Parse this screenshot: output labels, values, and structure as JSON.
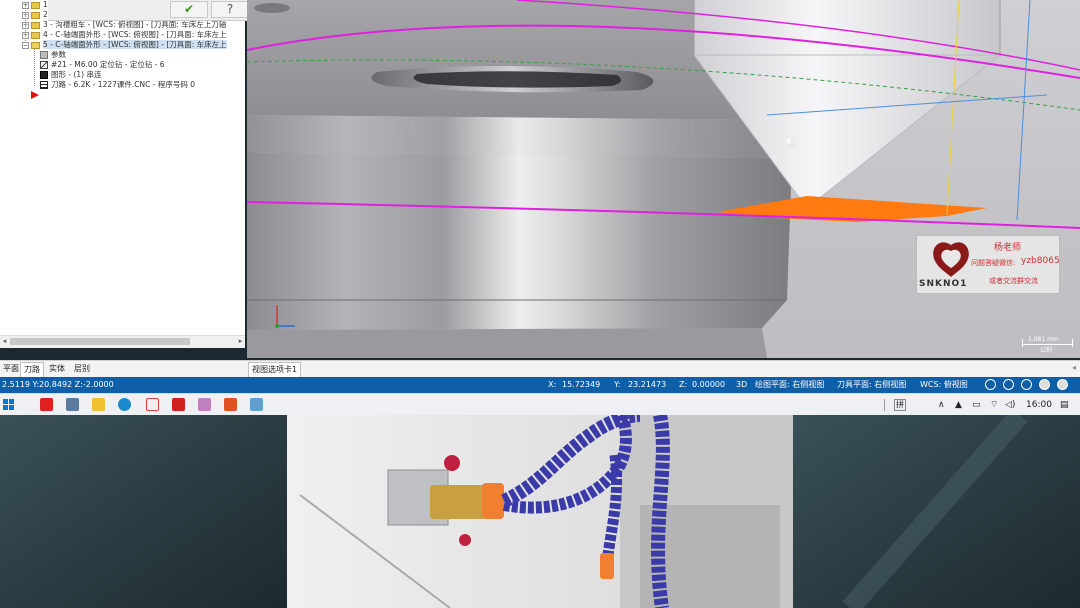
{
  "tree": {
    "rows": [
      {
        "label": "1 - ",
        "indent": 0,
        "kind": "folder"
      },
      {
        "label": "2 - ",
        "indent": 0,
        "kind": "folder"
      },
      {
        "label": "3 - 沟槽粗车 - [WCS: 俯视图] - [刀具面: 车床左上刀轴",
        "indent": 0,
        "kind": "folder"
      },
      {
        "label": "4 - C-轴端面外形 - [WCS: 俯视图] - [刀具面: 车床左上",
        "indent": 0,
        "kind": "folder"
      },
      {
        "label": "5 - C-轴端面外形 - [WCS: 俯视图] - [刀具面: 车床左上",
        "indent": 0,
        "kind": "folder-selected"
      },
      {
        "label": "参数",
        "indent": 1,
        "kind": "params"
      },
      {
        "label": "#21 - M6.00 定位钻 - 定位钻 - 6",
        "indent": 1,
        "kind": "tool"
      },
      {
        "label": "图形 - (1) 串连",
        "indent": 1,
        "kind": "geometry"
      },
      {
        "label": "刀路 - 6.2K - 1227课件.CNC - 程序号码 0",
        "indent": 1,
        "kind": "toolpath"
      }
    ],
    "ok_icon": "check-icon",
    "help_icon": "help-icon"
  },
  "tabs": {
    "left": [
      "平面",
      "刀路",
      "实体",
      "层别"
    ],
    "active_left": "刀路",
    "viewport_tab": "视图选项卡1"
  },
  "watermark": {
    "logo_text": "SNKNO1",
    "teacher": "杨老师",
    "contact_label": "问题答疑微信:",
    "wechat": "yzb8065",
    "group": "或者交流群交流"
  },
  "scale": {
    "value": "1.081 mm",
    "unit": "公制"
  },
  "status": {
    "left_coords": "2.5119  Y:20.8492  Z:-2.0000",
    "x_label": "X:",
    "x_value": "15.72349",
    "y_label": "Y:",
    "y_value": "23.21473",
    "z_label": "Z:",
    "z_value": "0.00000",
    "mode": "3D",
    "draw_plane": "绘图平面: 右侧视图",
    "tool_plane": "刀具平面: 右侧视图",
    "wcs": "WCS: 俯视图"
  },
  "taskbar": {
    "time": "16:00",
    "ime": "拼",
    "colors": {
      "accent": "#0f5fa8",
      "toolpath": "#e020e0",
      "orange": "#ff7a10"
    }
  }
}
